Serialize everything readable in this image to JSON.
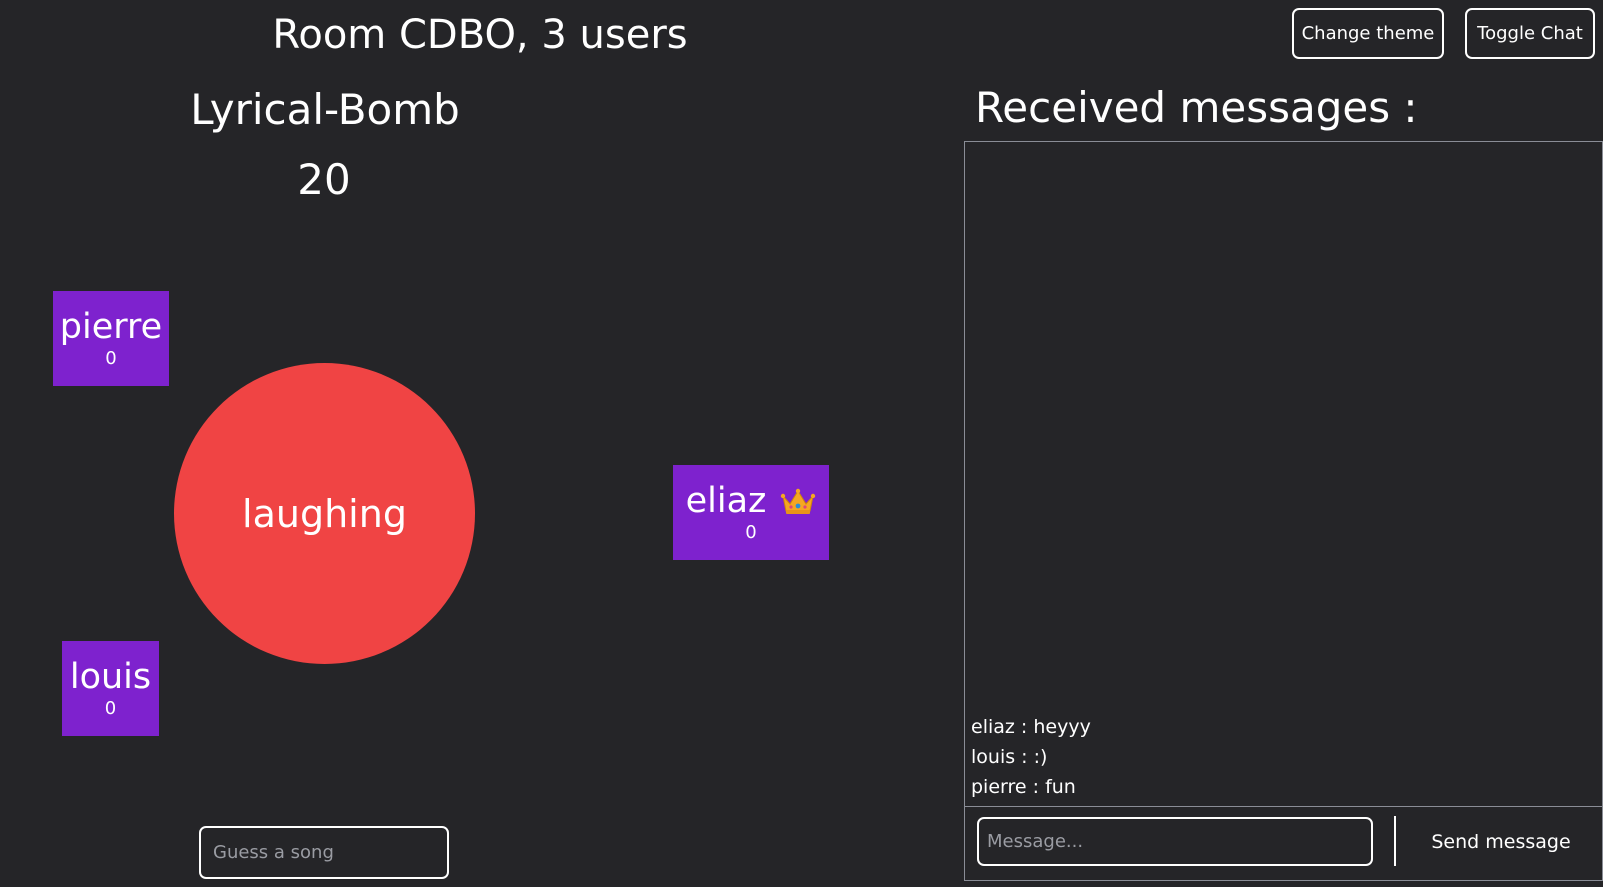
{
  "header": {
    "room_title": "Room CDBO, 3 users",
    "change_theme_label": "Change theme",
    "toggle_chat_label": "Toggle Chat"
  },
  "game": {
    "title": "Lyrical-Bomb",
    "timer": "20",
    "prompt_word": "laughing",
    "guess_placeholder": "Guess a song",
    "players": [
      {
        "name": "pierre",
        "score": "0"
      },
      {
        "name": "louis",
        "score": "0"
      },
      {
        "name": "eliaz",
        "score": "0",
        "icon": "crown-icon"
      }
    ]
  },
  "chat": {
    "title": "Received messages :",
    "messages": [
      "eliaz : heyyy",
      "louis : :)",
      "pierre : fun"
    ],
    "input_placeholder": "Message...",
    "send_label": "Send message"
  },
  "colors": {
    "background": "#252528",
    "player_card": "#7e22ce",
    "bomb": "#f04444"
  }
}
